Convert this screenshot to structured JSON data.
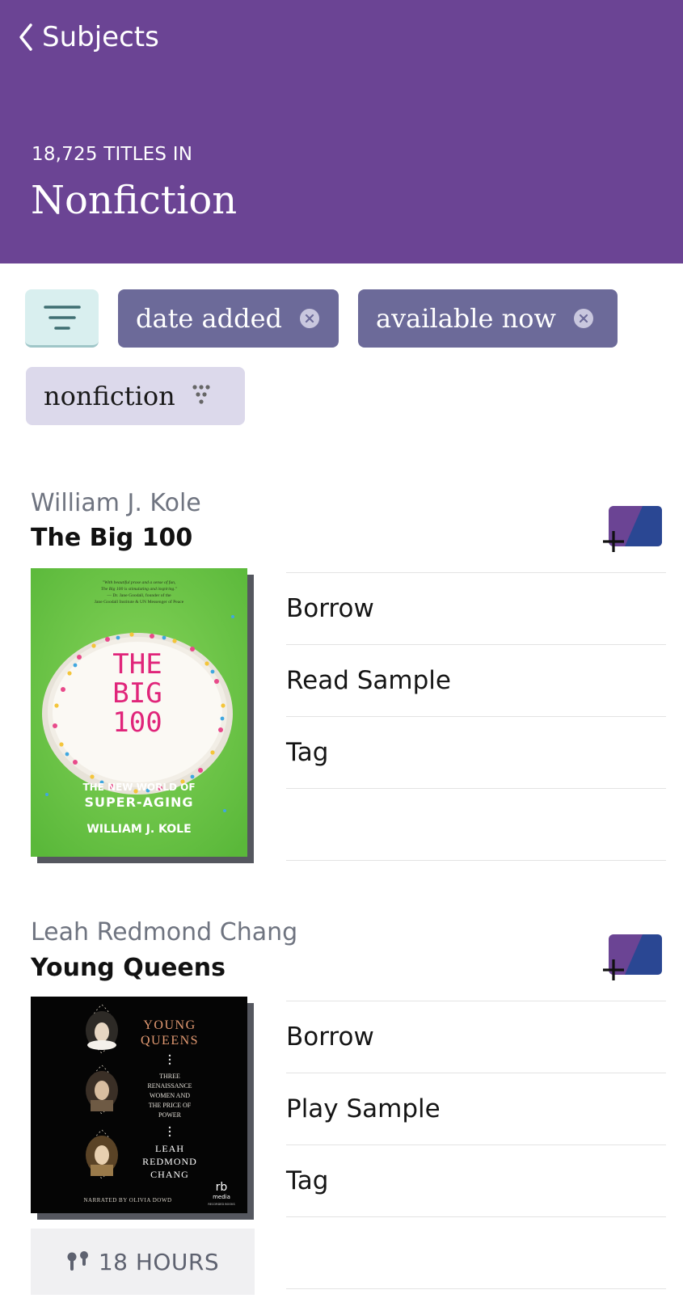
{
  "header": {
    "back_label": "Subjects",
    "count_text": "18,725 TITLES IN",
    "subject": "Nonfiction",
    "bg_color": "#6b4494"
  },
  "filters": {
    "chips": [
      {
        "label": "date added",
        "removable": true
      },
      {
        "label": "available now",
        "removable": true
      },
      {
        "label": "nonfiction",
        "removable": false
      }
    ]
  },
  "books": [
    {
      "author": "William J. Kole",
      "title": "The Big 100",
      "cover": {
        "quote_line1": "\"With beautiful prose and a sense of fun,",
        "quote_line2": "The Big 100 is stimulating and inspiring.\"",
        "quote_line3": "— Dr. Jane Goodall, founder of the",
        "quote_line4": "Jane Goodall Institute & UN Messenger of Peace",
        "big1": "THE",
        "big2": "BIG",
        "big3": "100",
        "sub1": "THE NEW WORLD OF",
        "sub2": "SUPER-AGING",
        "author": "WILLIAM J. KOLE"
      },
      "actions": [
        "Borrow",
        "Read Sample",
        "Tag"
      ]
    },
    {
      "author": "Leah Redmond Chang",
      "title": "Young Queens",
      "cover": {
        "t1": "YOUNG",
        "t2": "QUEENS",
        "s1": "THREE",
        "s2": "RENAISSANCE",
        "s3": "WOMEN AND",
        "s4": "THE PRICE OF",
        "s5": "POWER",
        "a1": "LEAH",
        "a2": "REDMOND",
        "a3": "CHANG",
        "narr": "NARRATED BY OLIVIA DOWD",
        "logo1": "rb",
        "logo2": "media",
        "logo3": "RECORDED BOOKS"
      },
      "actions": [
        "Borrow",
        "Play Sample",
        "Tag"
      ],
      "duration": "18 HOURS"
    }
  ]
}
